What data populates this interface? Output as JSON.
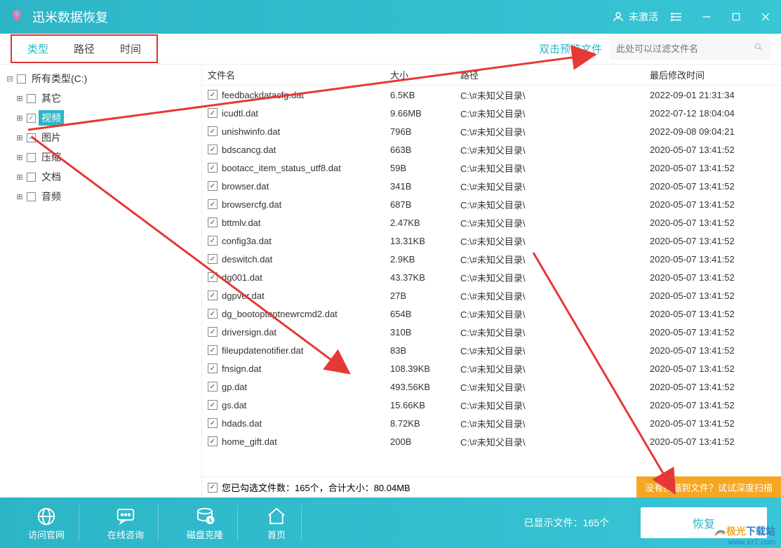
{
  "app_title": "迅米数据恢复",
  "user_status": "未激活",
  "tabs": {
    "type": "类型",
    "path": "路径",
    "time": "时间"
  },
  "preview_hint": "双击预览文件",
  "search_placeholder": "此处可以过滤文件名",
  "tree": {
    "root": "所有类型(C:)",
    "items": [
      {
        "label": "其它",
        "checked": false
      },
      {
        "label": "视频",
        "checked": true,
        "highlight": true
      },
      {
        "label": "图片",
        "checked": true
      },
      {
        "label": "压缩",
        "checked": false
      },
      {
        "label": "文档",
        "checked": false
      },
      {
        "label": "音频",
        "checked": false
      }
    ]
  },
  "columns": {
    "name": "文件名",
    "size": "大小",
    "path": "路径",
    "date": "最后修改时间"
  },
  "files": [
    {
      "name": "feedbackdatacfg.dat",
      "size": "6.5KB",
      "path": "C:\\#未知父目录\\",
      "date": "2022-09-01 21:31:34"
    },
    {
      "name": "icudtl.dat",
      "size": "9.66MB",
      "path": "C:\\#未知父目录\\",
      "date": "2022-07-12 18:04:04"
    },
    {
      "name": "unishwinfo.dat",
      "size": "796B",
      "path": "C:\\#未知父目录\\",
      "date": "2022-09-08 09:04:21"
    },
    {
      "name": "bdscancg.dat",
      "size": "663B",
      "path": "C:\\#未知父目录\\",
      "date": "2020-05-07 13:41:52"
    },
    {
      "name": "bootacc_item_status_utf8.dat",
      "size": "59B",
      "path": "C:\\#未知父目录\\",
      "date": "2020-05-07 13:41:52"
    },
    {
      "name": "browser.dat",
      "size": "341B",
      "path": "C:\\#未知父目录\\",
      "date": "2020-05-07 13:41:52"
    },
    {
      "name": "browsercfg.dat",
      "size": "687B",
      "path": "C:\\#未知父目录\\",
      "date": "2020-05-07 13:41:52"
    },
    {
      "name": "bttmlv.dat",
      "size": "2.47KB",
      "path": "C:\\#未知父目录\\",
      "date": "2020-05-07 13:41:52"
    },
    {
      "name": "config3a.dat",
      "size": "13.31KB",
      "path": "C:\\#未知父目录\\",
      "date": "2020-05-07 13:41:52"
    },
    {
      "name": "deswitch.dat",
      "size": "2.9KB",
      "path": "C:\\#未知父目录\\",
      "date": "2020-05-07 13:41:52"
    },
    {
      "name": "dg001.dat",
      "size": "43.37KB",
      "path": "C:\\#未知父目录\\",
      "date": "2020-05-07 13:41:52"
    },
    {
      "name": "dgpver.dat",
      "size": "27B",
      "path": "C:\\#未知父目录\\",
      "date": "2020-05-07 13:41:52"
    },
    {
      "name": "dg_bootoptoptnewrcmd2.dat",
      "size": "654B",
      "path": "C:\\#未知父目录\\",
      "date": "2020-05-07 13:41:52"
    },
    {
      "name": "driversign.dat",
      "size": "310B",
      "path": "C:\\#未知父目录\\",
      "date": "2020-05-07 13:41:52"
    },
    {
      "name": "fileupdatenotifier.dat",
      "size": "83B",
      "path": "C:\\#未知父目录\\",
      "date": "2020-05-07 13:41:52"
    },
    {
      "name": "fnsign.dat",
      "size": "108.39KB",
      "path": "C:\\#未知父目录\\",
      "date": "2020-05-07 13:41:52"
    },
    {
      "name": "gp.dat",
      "size": "493.56KB",
      "path": "C:\\#未知父目录\\",
      "date": "2020-05-07 13:41:52"
    },
    {
      "name": "gs.dat",
      "size": "15.66KB",
      "path": "C:\\#未知父目录\\",
      "date": "2020-05-07 13:41:52"
    },
    {
      "name": "hdads.dat",
      "size": "8.72KB",
      "path": "C:\\#未知父目录\\",
      "date": "2020-05-07 13:41:52"
    },
    {
      "name": "home_gift.dat",
      "size": "200B",
      "path": "C:\\#未知父目录\\",
      "date": "2020-05-07 13:41:52"
    }
  ],
  "summary": "您已勾选文件数：165个，合计大小：80.04MB",
  "deep_scan": "没有扫描到文件？试试深度扫描",
  "footer": {
    "website": "访问官网",
    "chat": "在线咨询",
    "clone": "磁盘克隆",
    "home": "首页",
    "shown": "已显示文件：165个",
    "recover": "恢复"
  },
  "watermark": {
    "brand1": "极光",
    "brand2": "下载站",
    "url": "www.xz7.com"
  }
}
